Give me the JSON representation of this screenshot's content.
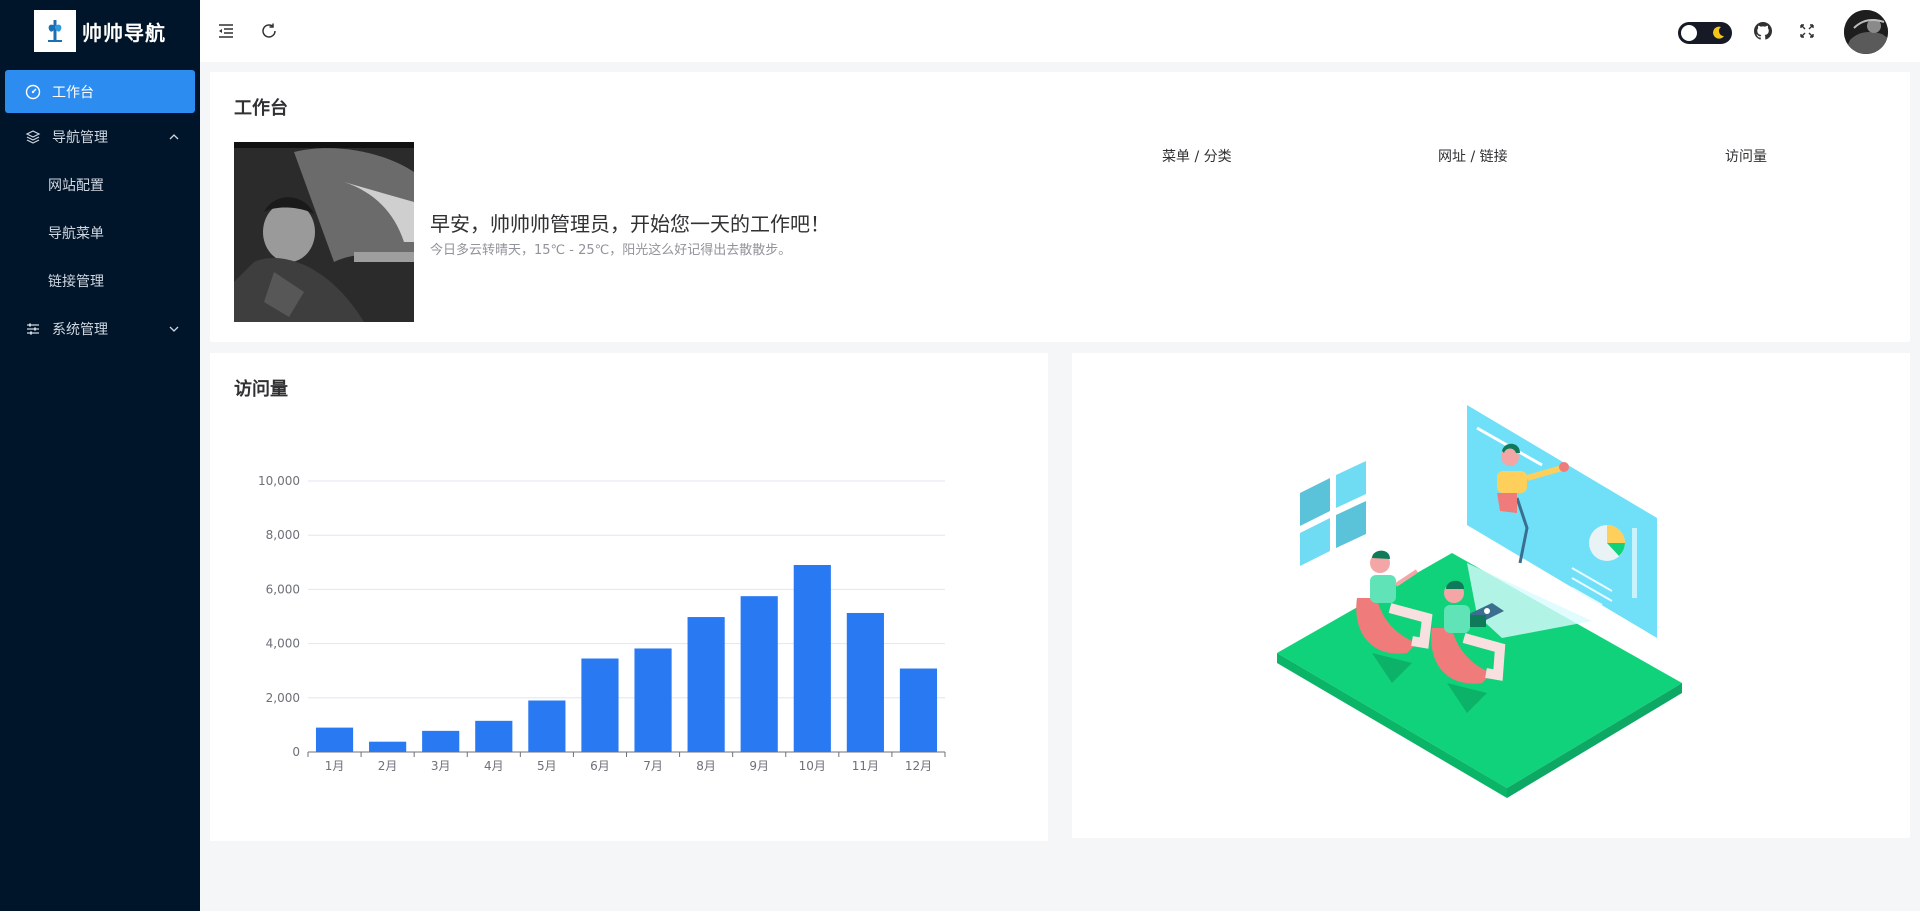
{
  "app": {
    "title": "帅帅导航"
  },
  "sidebar": {
    "items": [
      {
        "label": "工作台",
        "icon": "dashboard-icon",
        "active": true
      },
      {
        "label": "导航管理",
        "icon": "layers-icon",
        "expanded": true,
        "children": [
          {
            "label": "网站配置"
          },
          {
            "label": "导航菜单"
          },
          {
            "label": "链接管理"
          }
        ]
      },
      {
        "label": "系统管理",
        "icon": "sliders-icon",
        "expanded": false
      }
    ]
  },
  "header": {
    "icons": [
      "menu-fold-icon",
      "refresh-icon",
      "dark-mode-toggle",
      "github-icon",
      "fullscreen-icon",
      "user-avatar"
    ]
  },
  "workbench": {
    "title": "工作台",
    "greeting": "早安，帅帅帅管理员，开始您一天的工作吧！",
    "weather": "今日多云转晴天，15℃ - 25℃，阳光这么好记得出去散散步。",
    "stats": [
      {
        "label": "菜单 / 分类"
      },
      {
        "label": "网址 / 链接"
      },
      {
        "label": "访问量"
      }
    ]
  },
  "visits": {
    "title": "访问量"
  },
  "chart_data": {
    "type": "bar",
    "title": "",
    "categories": [
      "1月",
      "2月",
      "3月",
      "4月",
      "5月",
      "6月",
      "7月",
      "8月",
      "9月",
      "10月",
      "11月",
      "12月"
    ],
    "values": [
      900,
      380,
      780,
      1150,
      1900,
      3450,
      3820,
      4980,
      5750,
      6900,
      5130,
      3080
    ],
    "ylim": [
      0,
      10000
    ],
    "yticks": [
      0,
      2000,
      4000,
      6000,
      8000,
      10000
    ],
    "ytick_labels": [
      "0",
      "2,000",
      "4,000",
      "6,000",
      "8,000",
      "10,000"
    ],
    "bar_color": "#2979f2",
    "grid": true
  },
  "colors": {
    "sidebar_bg": "#001529",
    "accent": "#2d8cf0",
    "bar": "#2979f2",
    "floor": "#10d27a",
    "screen": "#6fe0f8"
  }
}
